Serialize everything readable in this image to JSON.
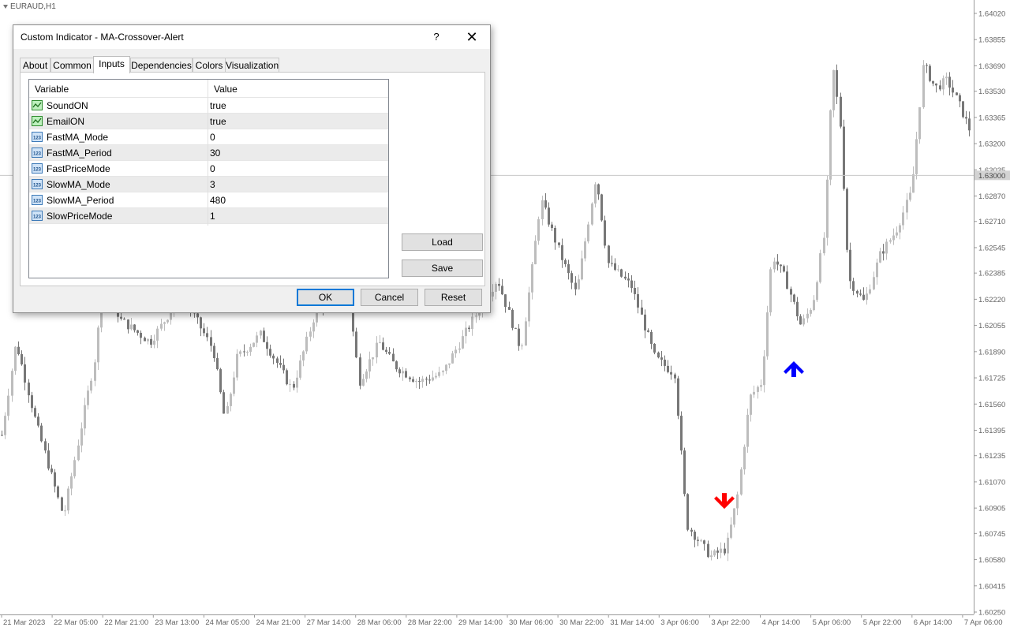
{
  "chart": {
    "symbol": "EURAUD,H1",
    "price_labels": [
      "1.64020",
      "1.63855",
      "1.63690",
      "1.63530",
      "1.63365",
      "1.63200",
      "1.63035",
      "1.62870",
      "1.62710",
      "1.62545",
      "1.62385",
      "1.62220",
      "1.62055",
      "1.61890",
      "1.61725",
      "1.61560",
      "1.61395",
      "1.61235",
      "1.61070",
      "1.60905",
      "1.60745",
      "1.60580",
      "1.60415",
      "1.60250"
    ],
    "current_price": "1.63000",
    "time_labels": [
      "21 Mar 2023",
      "22 Mar 05:00",
      "22 Mar 21:00",
      "23 Mar 13:00",
      "24 Mar 05:00",
      "24 Mar 21:00",
      "27 Mar 14:00",
      "28 Mar 06:00",
      "28 Mar 22:00",
      "29 Mar 14:00",
      "30 Mar 06:00",
      "30 Mar 22:00",
      "31 Mar 14:00",
      "3 Apr 06:00",
      "3 Apr 22:00",
      "4 Apr 14:00",
      "5 Apr 06:00",
      "5 Apr 22:00",
      "6 Apr 14:00",
      "7 Apr 06:00"
    ],
    "arrow_up_color": "#0000ff",
    "arrow_down_color": "#ff0000",
    "signals": [
      {
        "name": "sell-arrow-icon",
        "direction": "down",
        "price": 1.6093
      },
      {
        "name": "buy-arrow-icon",
        "direction": "up",
        "price": 1.618
      }
    ],
    "bull_color": "#bdbdbd",
    "bear_color": "#777777"
  },
  "dialog": {
    "title": "Custom Indicator - MA-Crossover-Alert",
    "help_label": "?",
    "close_label": "✕",
    "tabs": [
      "About",
      "Common",
      "Inputs",
      "Dependencies",
      "Colors",
      "Visualization"
    ],
    "active_tab": "Inputs",
    "grid": {
      "col_variable": "Variable",
      "col_value": "Value",
      "rows": [
        {
          "icon": "bool-icon",
          "variable": "SoundON",
          "value": "true"
        },
        {
          "icon": "bool-icon",
          "variable": "EmailON",
          "value": "true"
        },
        {
          "icon": "int-icon",
          "variable": "FastMA_Mode",
          "value": "0"
        },
        {
          "icon": "int-icon",
          "variable": "FastMA_Period",
          "value": "30"
        },
        {
          "icon": "int-icon",
          "variable": "FastPriceMode",
          "value": "0"
        },
        {
          "icon": "int-icon",
          "variable": "SlowMA_Mode",
          "value": "3"
        },
        {
          "icon": "int-icon",
          "variable": "SlowMA_Period",
          "value": "480"
        },
        {
          "icon": "int-icon",
          "variable": "SlowPriceMode",
          "value": "1"
        }
      ]
    },
    "load_label": "Load",
    "save_label": "Save",
    "ok_label": "OK",
    "cancel_label": "Cancel",
    "reset_label": "Reset"
  }
}
